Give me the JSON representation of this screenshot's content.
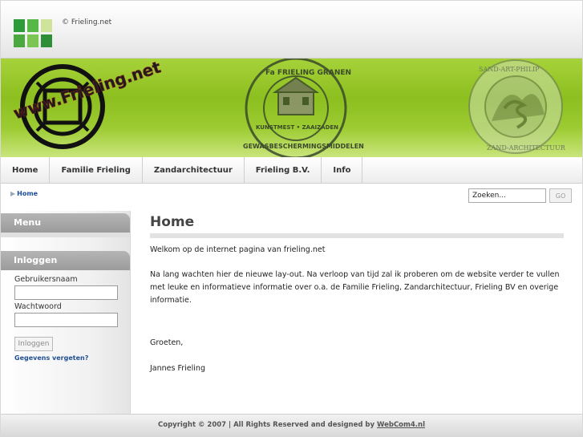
{
  "header": {
    "copyright_top": "© Frieling.net",
    "logo_colors": [
      "#2e9b3a",
      "#57b847",
      "#cfe39a",
      "#4aa83f",
      "#7bc652",
      "#2f8f38"
    ]
  },
  "banner": {
    "logo_text": "www.Frieling.net",
    "seal_top_text": "Fa FRIELING GRANEN",
    "seal_side_text": "KUNSTMEST • ZAAIZADEN",
    "seal_bottom_text": "GEWASBESCHERMINGSMIDDELEN",
    "right_seal_top": "SAND-ART-PHILIP",
    "right_seal_bottom": "ZAND-ARCHITECTUUR"
  },
  "nav": {
    "items": [
      {
        "label": "Home"
      },
      {
        "label": "Familie Frieling"
      },
      {
        "label": "Zandarchitectuur"
      },
      {
        "label": "Frieling B.V."
      },
      {
        "label": "Info"
      }
    ]
  },
  "breadcrumb": {
    "arrow": "▶",
    "current": "Home"
  },
  "search": {
    "value": "Zoeken...",
    "button_label": "GO"
  },
  "sidebar": {
    "menu_title": "Menu",
    "login_title": "Inloggen",
    "username_label": "Gebruikersnaam",
    "password_label": "Wachtwoord",
    "login_button": "Inloggen",
    "forgot_link": "Gegevens vergeten?"
  },
  "main": {
    "title": "Home",
    "welcome": "Welkom op de internet pagina van frieling.net",
    "body": "Na lang wachten hier de nieuwe lay-out. Na verloop van tijd zal ik proberen om de website verder te vullen met leuke en informatieve informatie over o.a. de Familie Frieling, Zandarchitectuur, Frieling BV en overige informatie.",
    "greeting": "Groeten,",
    "signature": "Jannes Frieling"
  },
  "footer": {
    "text": "Copyright © 2007 | All Rights Reserved and designed by ",
    "link": "WebCom4.nl"
  }
}
